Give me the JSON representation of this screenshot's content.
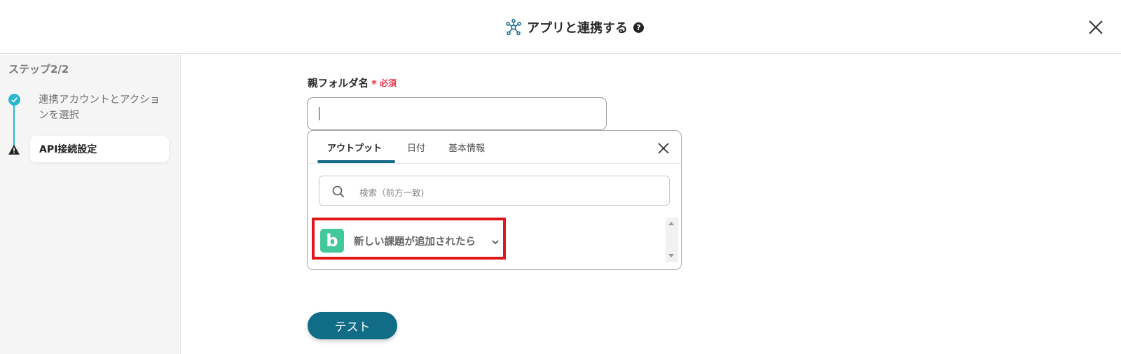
{
  "header": {
    "title": "アプリと連携する",
    "help_glyph": "?",
    "icon": "network-icon",
    "close_icon": "close-icon"
  },
  "sidebar": {
    "step_count": "ステップ2/2",
    "steps": [
      {
        "label": "連携アカウントとアクションを選択",
        "status": "completed",
        "icon": "check-icon"
      },
      {
        "label": "API接続設定",
        "status": "warning",
        "icon": "warning-icon"
      }
    ]
  },
  "form": {
    "field_label": "親フォルダ名",
    "required_mark": "*",
    "required_text": "必須",
    "value": ""
  },
  "popup": {
    "tabs": [
      {
        "label": "アウトプット",
        "active": true
      },
      {
        "label": "日付",
        "active": false
      },
      {
        "label": "基本情報",
        "active": false
      }
    ],
    "search_placeholder": "検索（前方一致)",
    "items": [
      {
        "label": "新しい課題が追加されたら",
        "app_letter": "b",
        "app_color": "#43c79c"
      }
    ]
  },
  "actions": {
    "test_label": "テスト"
  },
  "colors": {
    "accent": "#2bb8cc",
    "primary_button": "#116c86",
    "required": "#e8384f",
    "highlight_border": "#e0161b"
  }
}
